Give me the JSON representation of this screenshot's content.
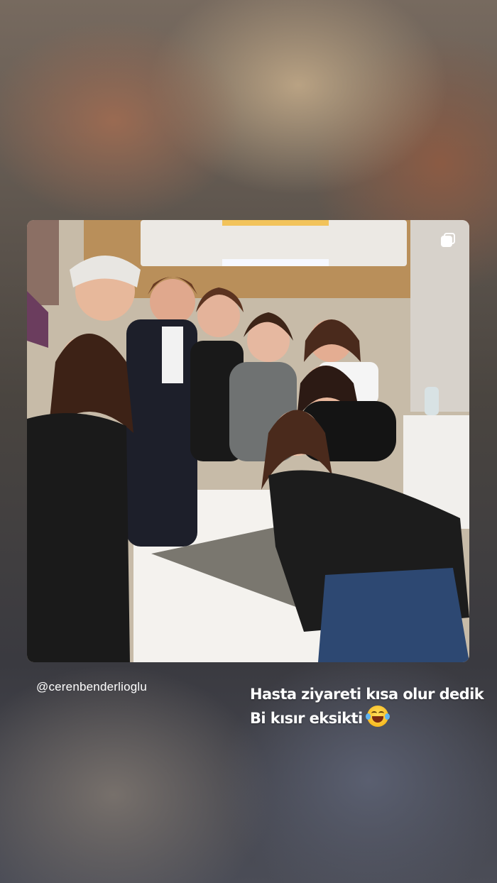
{
  "story": {
    "author_handle": "@cerenbenderlioglu",
    "caption_lines": [
      "Hasta ziyareti kısa olur dedik",
      "Bi kısır eksikti"
    ],
    "caption_emoji": "face-with-tears-of-joy-icon"
  },
  "post": {
    "media_type": "carousel",
    "indicator_icon": "multiple-posts-icon",
    "image_subject": "group-photo-hospital-room"
  }
}
